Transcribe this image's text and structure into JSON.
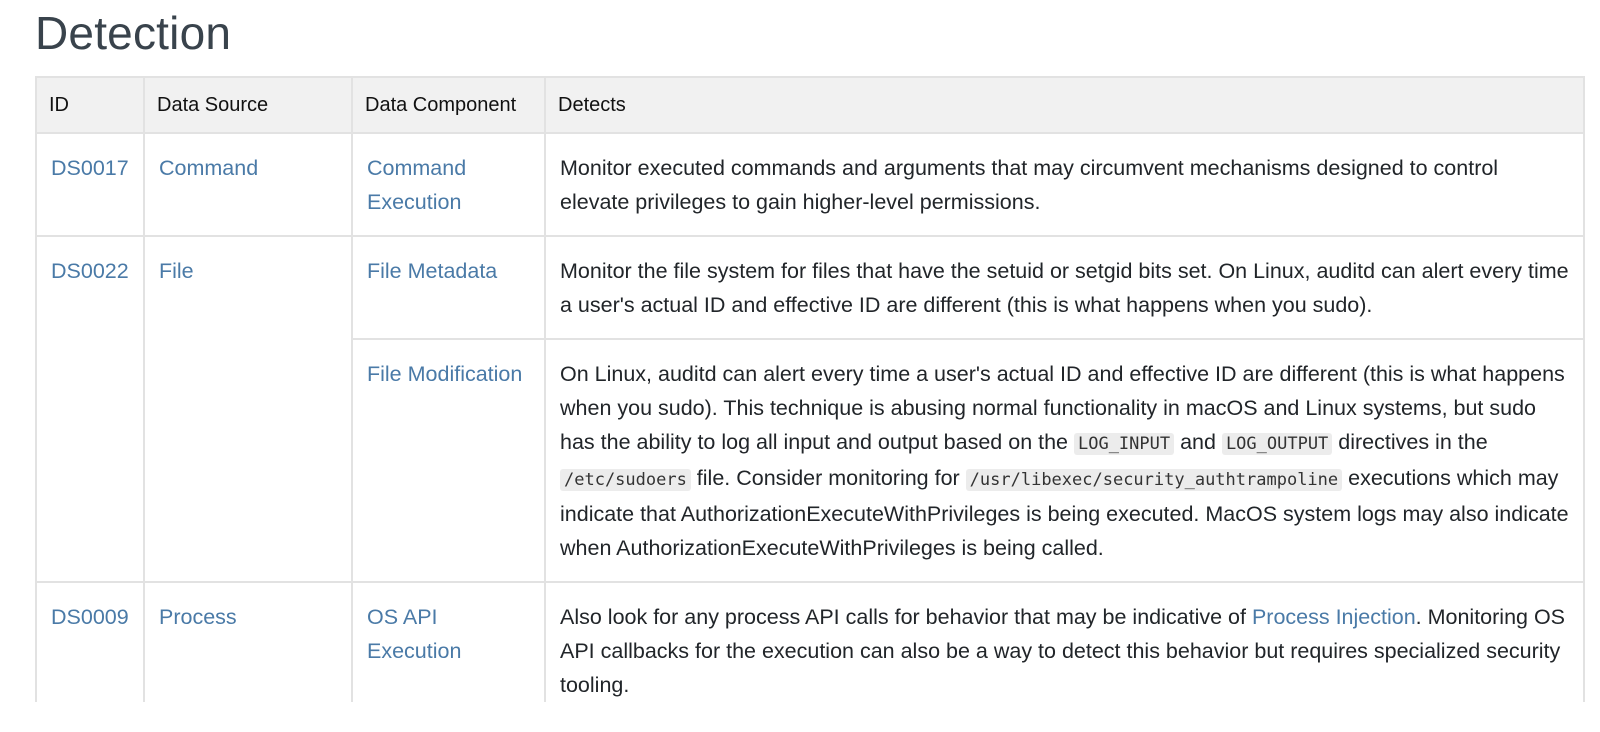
{
  "section_title": "Detection",
  "columns": [
    "ID",
    "Data Source",
    "Data Component",
    "Detects"
  ],
  "rows": [
    {
      "id": "DS0017",
      "source": "Command",
      "component": "Command Execution",
      "detects": "Monitor executed commands and arguments that may circumvent mechanisms designed to control elevate privileges to gain higher-level permissions."
    },
    {
      "id": "DS0022",
      "source": "File",
      "component": "File Metadata",
      "detects": "Monitor the file system for files that have the setuid or setgid bits set. On Linux, auditd can alert every time a user's actual ID and effective ID are different (this is what happens when you sudo)."
    },
    {
      "component": "File Modification",
      "detects_parts": [
        "On Linux, auditd can alert every time a user's actual ID and effective ID are different (this is what happens when you sudo). This technique is abusing normal functionality in macOS and Linux systems, but sudo has the ability to log all input and output based on the ",
        "LOG_INPUT",
        " and ",
        "LOG_OUTPUT",
        " directives in the ",
        "/etc/sudoers",
        " file. Consider monitoring for ",
        "/usr/libexec/security_authtrampoline",
        " executions which may indicate that AuthorizationExecuteWithPrivileges is being executed. MacOS system logs may also indicate when AuthorizationExecuteWithPrivileges is being called."
      ]
    },
    {
      "id": "DS0009",
      "source": "Process",
      "component": "OS API Execution",
      "detects_before": "Also look for any process API calls for behavior that may be indicative of ",
      "detects_link": "Process Injection",
      "detects_after": ". Monitoring OS API callbacks for the execution can also be a way to detect this behavior but requires specialized security tooling."
    }
  ],
  "colors": {
    "link": "#4a7aa7",
    "header_bg": "#f1f1f1",
    "border": "#e2e2e2",
    "title": "#39434c"
  }
}
